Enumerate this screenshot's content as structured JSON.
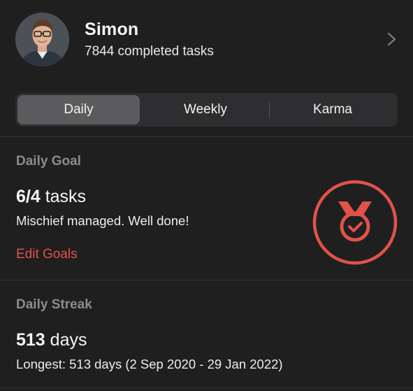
{
  "profile": {
    "name": "Simon",
    "completed_tasks": "7844 completed tasks"
  },
  "tabs": [
    {
      "label": "Daily",
      "active": true
    },
    {
      "label": "Weekly",
      "active": false
    },
    {
      "label": "Karma",
      "active": false
    }
  ],
  "daily_goal": {
    "title": "Daily Goal",
    "value_number": "6/4",
    "value_unit": " tasks",
    "message": "Mischief managed. Well done!",
    "edit_label": "Edit Goals"
  },
  "daily_streak": {
    "title": "Daily Streak",
    "value_number": "513",
    "value_unit": " days",
    "longest": "Longest: 513 days (2 Sep 2020 - 29 Jan 2022)"
  },
  "colors": {
    "background": "#1f1f1f",
    "accent": "#e0524a",
    "segment_bg": "#2e2e30",
    "segment_active": "#5b5b5d",
    "muted_text": "#8c8c8e"
  },
  "icons": {
    "chevron": "chevron-right-icon",
    "medal": "medal-check-icon"
  }
}
